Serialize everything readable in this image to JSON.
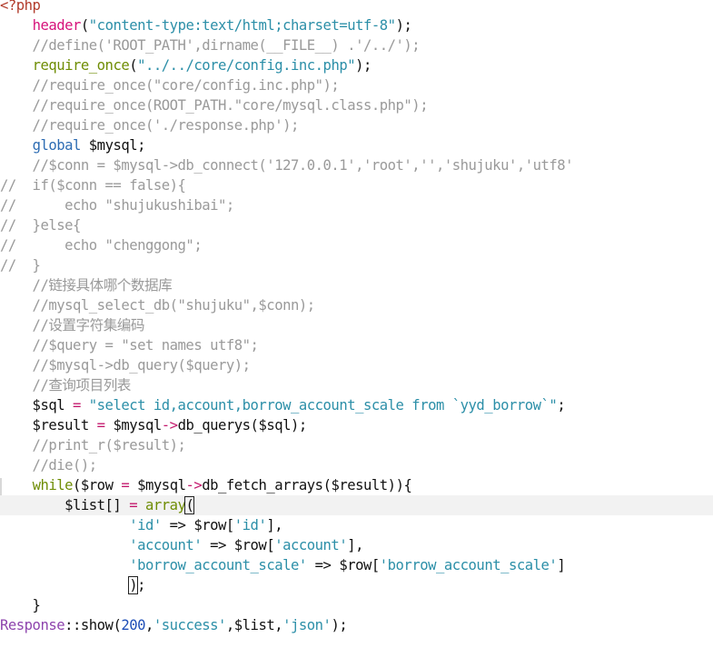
{
  "editor": {
    "language": "php",
    "active_line_index": 25,
    "colors": {
      "background": "#ffffff",
      "active_line": "#f2f2f2",
      "php_tag": "#b23b2b",
      "function": "#d6127b",
      "string": "#2c8fa8",
      "comment": "#9a9a9a",
      "keyword": "#6f8d05",
      "global_keyword": "#2d6cb3",
      "class": "#8e44ad",
      "number": "#1f4fb8"
    },
    "lines": [
      [
        {
          "t": "<?php",
          "c": "tag"
        }
      ],
      [
        {
          "t": "    ",
          "c": "pl"
        },
        {
          "t": "header",
          "c": "fn"
        },
        {
          "t": "(",
          "c": "pl"
        },
        {
          "t": "\"content-type:text/html;charset=utf-8\"",
          "c": "str"
        },
        {
          "t": ");",
          "c": "pl"
        }
      ],
      [
        {
          "t": "    //define('ROOT_PATH',dirname(__FILE__) .'/../');",
          "c": "cm"
        }
      ],
      [
        {
          "t": "    ",
          "c": "pl"
        },
        {
          "t": "require_once",
          "c": "kw"
        },
        {
          "t": "(",
          "c": "pl"
        },
        {
          "t": "\"../../core/config.inc.php\"",
          "c": "str"
        },
        {
          "t": ");",
          "c": "pl"
        }
      ],
      [
        {
          "t": "    //require_once(\"core/config.inc.php\");",
          "c": "cm"
        }
      ],
      [
        {
          "t": "    //require_once(ROOT_PATH.\"core/mysql.class.php\");",
          "c": "cm"
        }
      ],
      [
        {
          "t": "    //require_once('./response.php');",
          "c": "cm"
        }
      ],
      [
        {
          "t": "    ",
          "c": "pl"
        },
        {
          "t": "global",
          "c": "kw2"
        },
        {
          "t": " $mysql;",
          "c": "pl"
        }
      ],
      [
        {
          "t": "    //$conn = $mysql->db_connect('127.0.0.1','root','','shujuku','utf8'",
          "c": "cm"
        }
      ],
      [
        {
          "t": "//  if($conn == false){",
          "c": "cm"
        }
      ],
      [
        {
          "t": "//      echo \"shujukushibai\";",
          "c": "cm"
        }
      ],
      [
        {
          "t": "//  }else{",
          "c": "cm"
        }
      ],
      [
        {
          "t": "//      echo \"chenggong\";",
          "c": "cm"
        }
      ],
      [
        {
          "t": "//  }",
          "c": "cm"
        }
      ],
      [
        {
          "t": "    //链接具体哪个数据库",
          "c": "cm"
        }
      ],
      [
        {
          "t": "    //mysql_select_db(\"shujuku\",$conn);",
          "c": "cm"
        }
      ],
      [
        {
          "t": "    //设置字符集编码",
          "c": "cm"
        }
      ],
      [
        {
          "t": "    //$query = \"set names utf8\";",
          "c": "cm"
        }
      ],
      [
        {
          "t": "    //$mysql->db_query($query);",
          "c": "cm"
        }
      ],
      [
        {
          "t": "    //查询项目列表",
          "c": "cm"
        }
      ],
      [
        {
          "t": "    $sql ",
          "c": "pl"
        },
        {
          "t": "=",
          "c": "op"
        },
        {
          "t": " ",
          "c": "pl"
        },
        {
          "t": "\"select id,account,borrow_account_scale from `yyd_borrow`\"",
          "c": "str"
        },
        {
          "t": ";",
          "c": "pl"
        }
      ],
      [
        {
          "t": "    $result ",
          "c": "pl"
        },
        {
          "t": "=",
          "c": "op"
        },
        {
          "t": " $mysql",
          "c": "pl"
        },
        {
          "t": "->",
          "c": "op"
        },
        {
          "t": "db_querys($sql);",
          "c": "pl"
        }
      ],
      [
        {
          "t": "    //print_r($result);",
          "c": "cm"
        }
      ],
      [
        {
          "t": "    //die();",
          "c": "cm"
        }
      ],
      [
        {
          "t": "    ",
          "c": "pl"
        },
        {
          "t": "while",
          "c": "kw"
        },
        {
          "t": "($row ",
          "c": "pl"
        },
        {
          "t": "=",
          "c": "op"
        },
        {
          "t": " $mysql",
          "c": "pl"
        },
        {
          "t": "->",
          "c": "op"
        },
        {
          "t": "db_fetch_arrays($result)){",
          "c": "pl"
        }
      ],
      [
        {
          "t": "        $list[] ",
          "c": "pl"
        },
        {
          "t": "=",
          "c": "op"
        },
        {
          "t": " ",
          "c": "pl"
        },
        {
          "t": "array",
          "c": "kw"
        },
        {
          "t": "(",
          "c": "box"
        },
        {
          "t": "",
          "c": "cursor"
        }
      ],
      [
        {
          "t": "                ",
          "c": "pl"
        },
        {
          "t": "'id'",
          "c": "str"
        },
        {
          "t": " => $row[",
          "c": "pl"
        },
        {
          "t": "'id'",
          "c": "str"
        },
        {
          "t": "],",
          "c": "pl"
        }
      ],
      [
        {
          "t": "                ",
          "c": "pl"
        },
        {
          "t": "'account'",
          "c": "str"
        },
        {
          "t": " => $row[",
          "c": "pl"
        },
        {
          "t": "'account'",
          "c": "str"
        },
        {
          "t": "],",
          "c": "pl"
        }
      ],
      [
        {
          "t": "                ",
          "c": "pl"
        },
        {
          "t": "'borrow_account_scale'",
          "c": "str"
        },
        {
          "t": " => $row[",
          "c": "pl"
        },
        {
          "t": "'borrow_account_scale'",
          "c": "str"
        },
        {
          "t": "]",
          "c": "pl"
        }
      ],
      [
        {
          "t": "                ",
          "c": "pl"
        },
        {
          "t": ")",
          "c": "box"
        },
        {
          "t": ";",
          "c": "pl"
        }
      ],
      [
        {
          "t": "    }",
          "c": "pl"
        }
      ],
      [
        {
          "t": "Response",
          "c": "cls"
        },
        {
          "t": "::show(",
          "c": "pl"
        },
        {
          "t": "200",
          "c": "num"
        },
        {
          "t": ",",
          "c": "pl"
        },
        {
          "t": "'success'",
          "c": "str"
        },
        {
          "t": ",$list,",
          "c": "pl"
        },
        {
          "t": "'json'",
          "c": "str"
        },
        {
          "t": ");",
          "c": "pl"
        }
      ]
    ]
  }
}
